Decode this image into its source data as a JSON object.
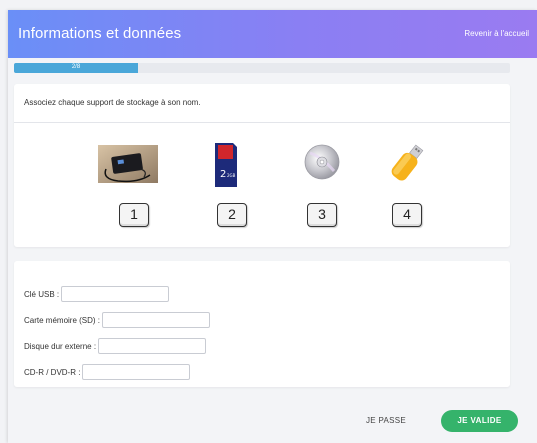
{
  "header": {
    "title": "Informations et données",
    "back_link": "Revenir à l'accueil"
  },
  "progress": {
    "label": "2/8",
    "fraction": 0.25
  },
  "question": {
    "instruction": "Associez chaque support de stockage à son nom.",
    "media": [
      {
        "number": "1",
        "icon": "external-hard-drive-icon"
      },
      {
        "number": "2",
        "icon": "sd-card-icon",
        "card_label": "2GB"
      },
      {
        "number": "3",
        "icon": "cd-dvd-icon"
      },
      {
        "number": "4",
        "icon": "usb-key-icon"
      }
    ]
  },
  "form": {
    "fields": [
      {
        "label": "Clé USB :",
        "value": ""
      },
      {
        "label": "Carte mémoire (SD) :",
        "value": ""
      },
      {
        "label": "Disque dur externe :",
        "value": ""
      },
      {
        "label": "CD-R / DVD-R :",
        "value": ""
      }
    ]
  },
  "actions": {
    "skip_label": "JE PASSE",
    "submit_label": "JE VALIDE"
  },
  "colors": {
    "header_start": "#6a8ff7",
    "header_end": "#9a7bf1",
    "progress": "#4aa7d9",
    "submit": "#35b36b"
  }
}
